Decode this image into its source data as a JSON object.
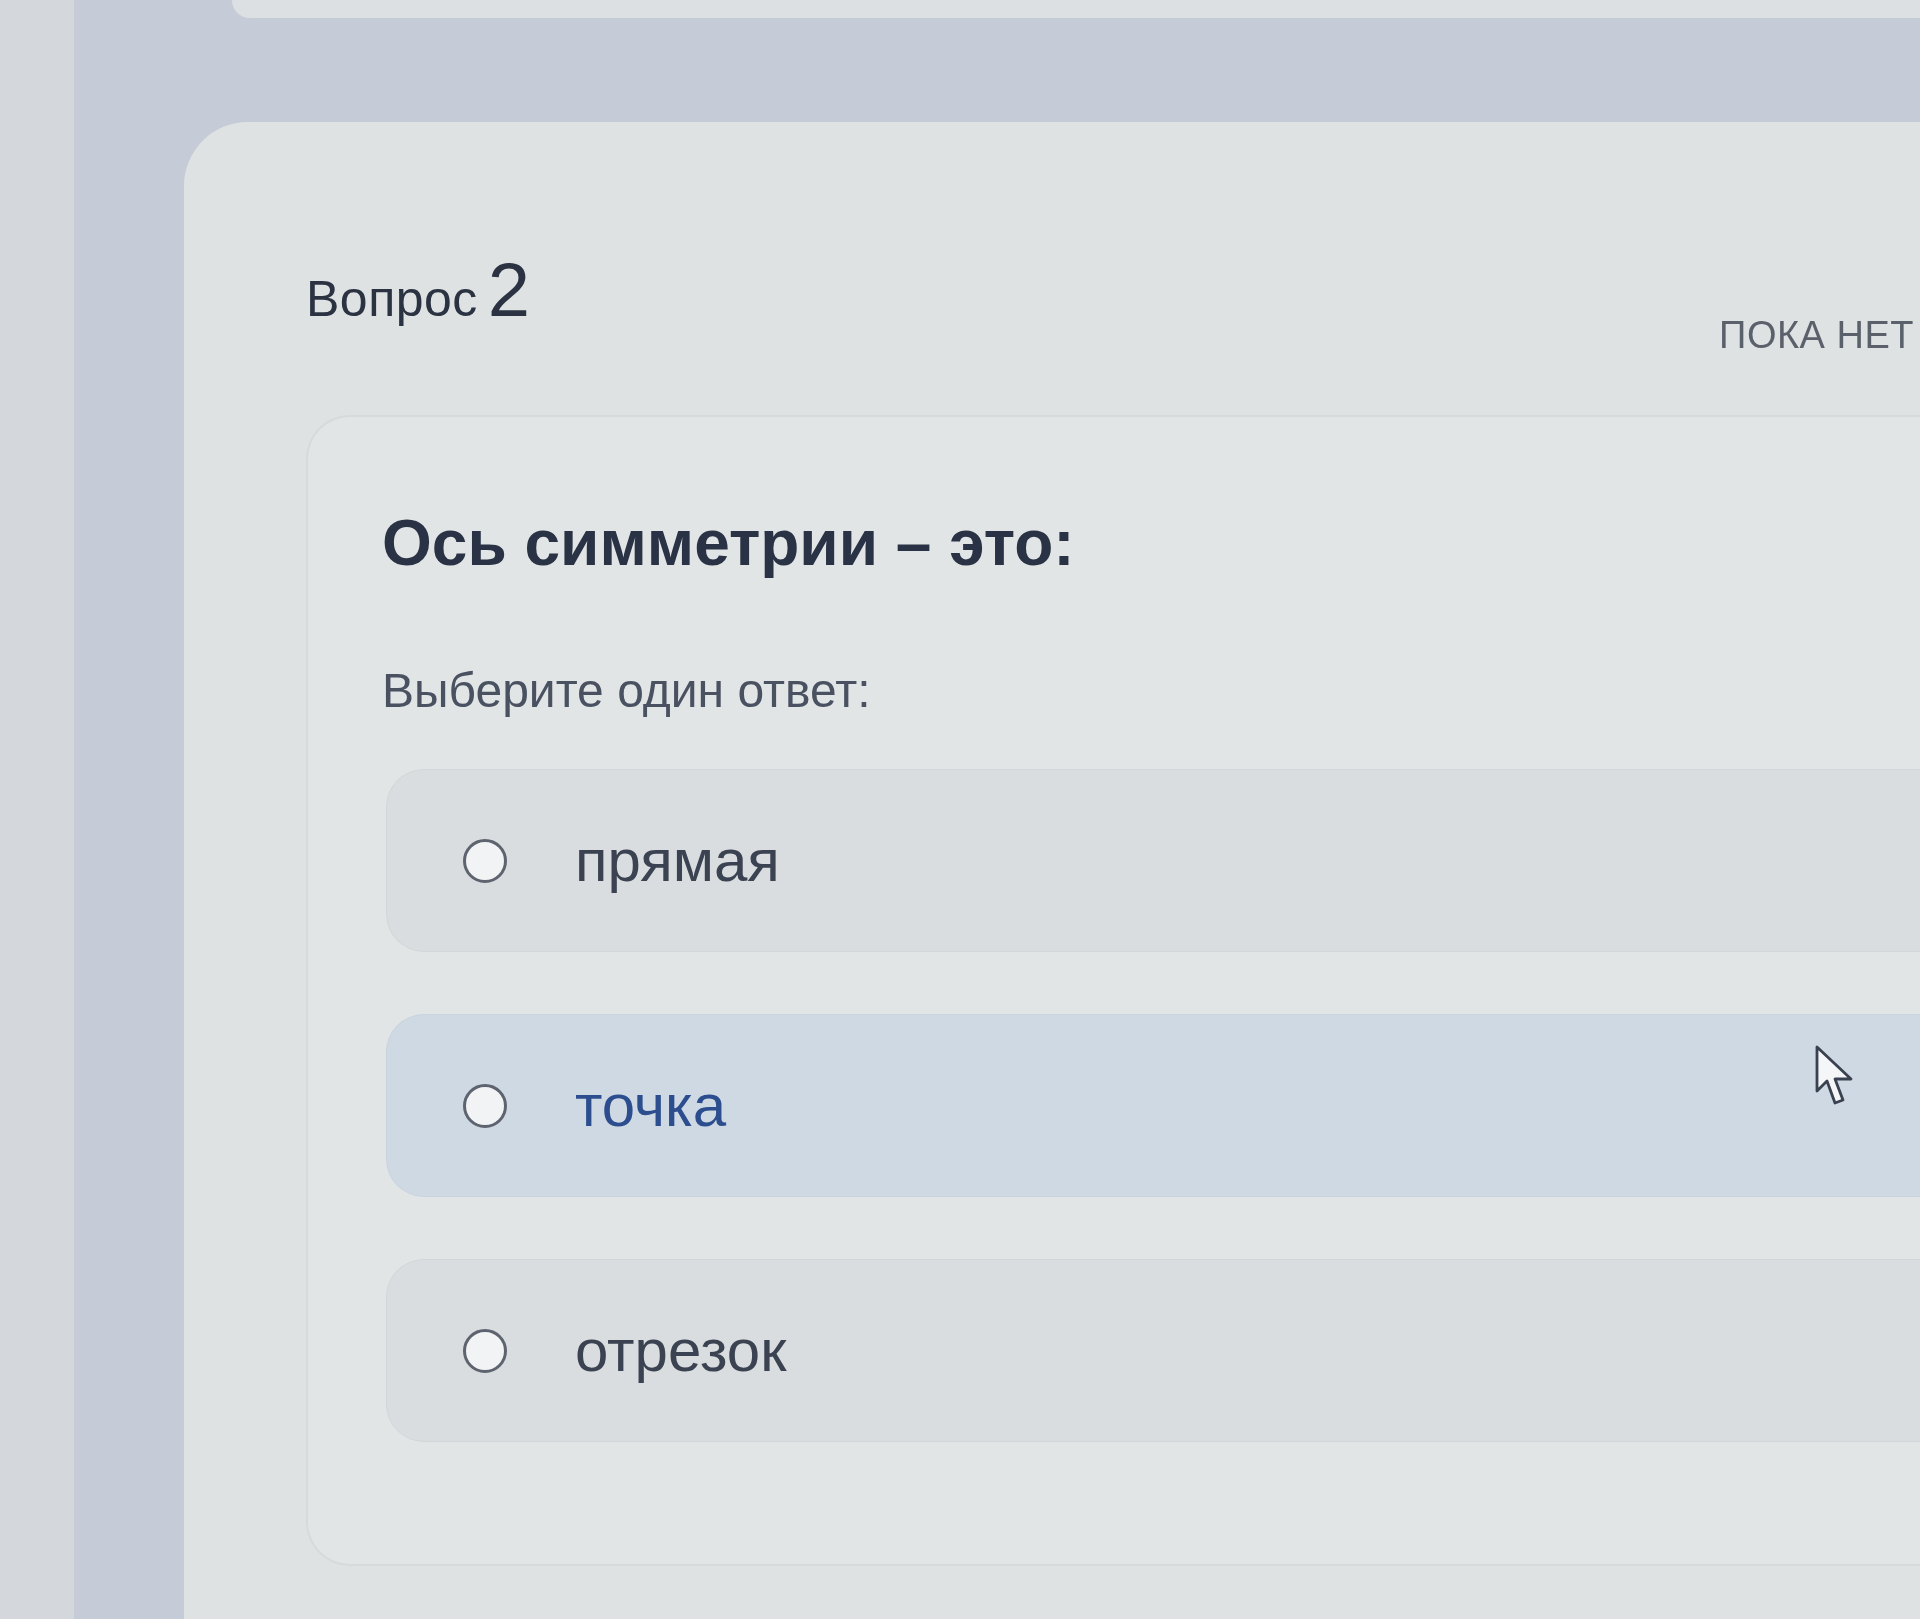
{
  "question": {
    "label": "Вопрос",
    "number": "2",
    "status": "ПОКА НЕТ"
  },
  "prompt": {
    "text": "Ось симметрии – это:",
    "instruction": "Выберите один ответ:"
  },
  "options": [
    {
      "text": "прямая",
      "selected": false,
      "highlighted": false
    },
    {
      "text": "точка",
      "selected": false,
      "highlighted": true
    },
    {
      "text": "отрезок",
      "selected": false,
      "highlighted": false
    }
  ]
}
